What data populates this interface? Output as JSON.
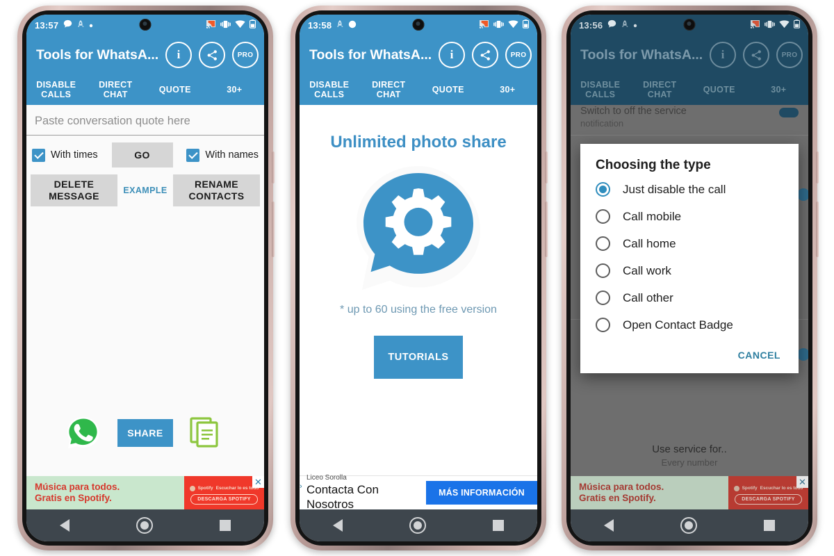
{
  "app": {
    "title": "Tools for WhatsA...",
    "header_icons": [
      {
        "name": "info-icon",
        "label": "i"
      },
      {
        "name": "share-icon",
        "label": ""
      },
      {
        "name": "pro-badge-icon",
        "label": "PRO"
      }
    ],
    "tabs": [
      {
        "label": "DISABLE\nCALLS"
      },
      {
        "label": "DIRECT\nCHAT"
      },
      {
        "label": "QUOTE"
      },
      {
        "label": "30+"
      }
    ],
    "colors": {
      "accent": "#3d93c7",
      "accent_dim": "#1f4a63",
      "link": "#3d8fb8",
      "grey_button": "#d6d6d6",
      "navbar": "#3e464d",
      "whatsapp_green": "#2fb84b",
      "copy_green": "#8dc63f"
    }
  },
  "phone1": {
    "status": {
      "time": "13:57",
      "icons_left": [
        "chat-bubble-icon",
        "rocket-icon",
        "dot-icon"
      ],
      "icons_right": [
        "cast-icon",
        "vibrate-icon",
        "wifi-icon",
        "battery-icon"
      ]
    },
    "quote_input": {
      "placeholder": "Paste conversation quote here",
      "value": ""
    },
    "checkbox_times": {
      "label": "With times",
      "checked": true
    },
    "checkbox_names": {
      "label": "With names",
      "checked": true
    },
    "go_button": "GO",
    "delete_button": "DELETE\nMESSAGE",
    "example_link": "EXAMPLE",
    "rename_button": "RENAME\nCONTACTS",
    "share_button": "SHARE",
    "ad": {
      "line1": "Música para todos.",
      "line2": "Gratis en Spotify.",
      "brand": "Spotify",
      "brand_tail": "Escuchar lo es todo",
      "cta": "DESCARGA SPOTIFY",
      "close": "✕"
    }
  },
  "phone2": {
    "status": {
      "time": "13:58",
      "icons_left": [
        "rocket-icon",
        "circle-icon"
      ],
      "icons_right": [
        "cast-icon",
        "vibrate-icon",
        "wifi-icon",
        "battery-icon"
      ]
    },
    "title": "Unlimited photo share",
    "note": "* up to 60 using the free version",
    "tutorials_button": "TUTORIALS",
    "ad": {
      "advertiser": "Liceo Sorolla",
      "headline": "Contacta Con Nosotros",
      "cta": "MÁS INFORMACIÓN"
    }
  },
  "phone3": {
    "status": {
      "time": "13:56",
      "icons_left": [
        "chat-bubble-icon",
        "rocket-icon",
        "dot-icon"
      ],
      "icons_right": [
        "cast-icon",
        "vibrate-icon",
        "wifi-icon",
        "battery-icon"
      ]
    },
    "behind": {
      "row_top": {
        "title": "Switch to off the service",
        "subtitle": "notification"
      },
      "row_bottom": {
        "title": "Use service for..",
        "subtitle": "Every number"
      }
    },
    "dialog": {
      "title": "Choosing the type",
      "options": [
        {
          "label": "Just disable the call",
          "selected": true
        },
        {
          "label": "Call mobile",
          "selected": false
        },
        {
          "label": "Call home",
          "selected": false
        },
        {
          "label": "Call work",
          "selected": false
        },
        {
          "label": "Call other",
          "selected": false
        },
        {
          "label": "Open Contact Badge",
          "selected": false
        }
      ],
      "cancel": "CANCEL"
    },
    "ad": {
      "line1": "Música para todos.",
      "line2": "Gratis en Spotify.",
      "brand": "Spotify",
      "brand_tail": "Escuchar lo es todo",
      "cta": "DESCARGA SPOTIFY",
      "close": "✕"
    }
  },
  "navbar": {
    "back": "back-icon",
    "home": "home-icon",
    "recents": "recents-icon"
  }
}
